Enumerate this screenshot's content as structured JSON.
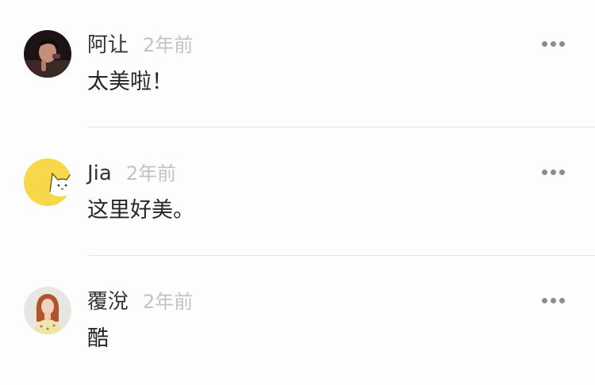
{
  "comments": [
    {
      "username": "阿让",
      "timestamp": "2年前",
      "text": "太美啦！",
      "avatar": "dark-portrait-photo",
      "more_icon": "more-dots-icon"
    },
    {
      "username": "Jia",
      "timestamp": "2年前",
      "text": "这里好美。",
      "avatar": "yellow-cat-avatar",
      "more_icon": "more-dots-icon"
    },
    {
      "username": "覆涗",
      "timestamp": "2年前",
      "text": "酷",
      "avatar": "red-hair-portrait-photo",
      "more_icon": "more-dots-icon"
    }
  ],
  "colors": {
    "background": "#fdfdfd",
    "username": "#333333",
    "timestamp": "#c2c2c2",
    "divider": "#e6e6e6",
    "avatar_yellow": "#f6d84a"
  }
}
